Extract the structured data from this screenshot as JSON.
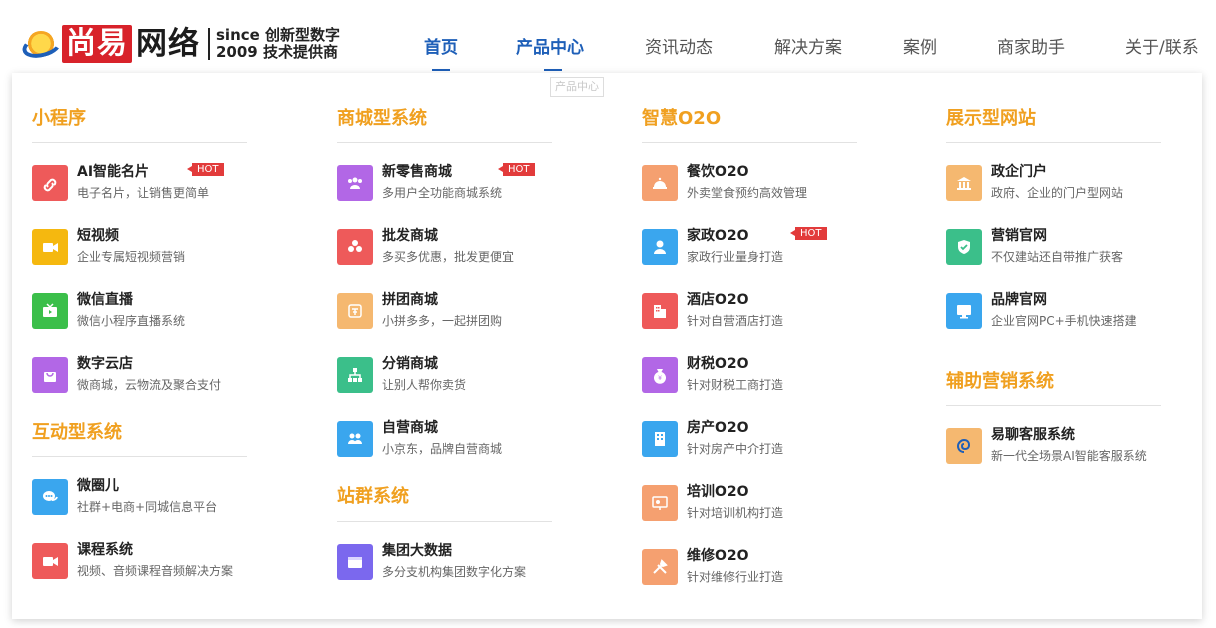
{
  "header": {
    "logo": {
      "red": "尚易",
      "black": "网络",
      "tag_line1": "since 创新型数字",
      "tag_line2": "2009 技术提供商"
    },
    "nav": [
      {
        "label": "首页",
        "active": true
      },
      {
        "label": "产品中心",
        "active": true
      },
      {
        "label": "资讯动态",
        "active": false
      },
      {
        "label": "解决方案",
        "active": false
      },
      {
        "label": "案例",
        "active": false
      },
      {
        "label": "商家助手",
        "active": false
      },
      {
        "label": "关于/联系",
        "active": false
      }
    ],
    "tooltip": "产品中心"
  },
  "hot_label": "HOT",
  "columns": {
    "miniprogram": {
      "title": "小程序",
      "items": [
        {
          "title": "AI智能名片",
          "desc": "电子名片，让销售更简单",
          "hot": true,
          "icon": "link-icon",
          "color": "#ee5a5a"
        },
        {
          "title": "短视频",
          "desc": "企业专属短视频营销",
          "hot": false,
          "icon": "video-camera-icon",
          "color": "#f5b80f"
        },
        {
          "title": "微信直播",
          "desc": "微信小程序直播系统",
          "hot": false,
          "icon": "tv-icon",
          "color": "#3bbf4a"
        },
        {
          "title": "数字云店",
          "desc": "微商城，云物流及聚合支付",
          "hot": false,
          "icon": "shopping-bag-icon",
          "color": "#b267e6"
        }
      ]
    },
    "interactive": {
      "title": "互动型系统",
      "items": [
        {
          "title": "微圈儿",
          "desc": "社群+电商+同城信息平台",
          "hot": false,
          "icon": "chat-bubbles-icon",
          "color": "#3aa6ee"
        },
        {
          "title": "课程系统",
          "desc": "视频、音频课程音频解决方案",
          "hot": false,
          "icon": "video-icon",
          "color": "#ee5a5a"
        }
      ]
    },
    "mall": {
      "title": "商城型系统",
      "items": [
        {
          "title": "新零售商城",
          "desc": "多用户全功能商城系统",
          "hot": true,
          "icon": "users-icon",
          "color": "#b267e6"
        },
        {
          "title": "批发商城",
          "desc": "多买多优惠，批发更便宜",
          "hot": false,
          "icon": "boxes-icon",
          "color": "#ee5a5a"
        },
        {
          "title": "拼团商城",
          "desc": "小拼多多，一起拼团购",
          "hot": false,
          "icon": "group-icon",
          "color": "#f5b870"
        },
        {
          "title": "分销商城",
          "desc": "让别人帮你卖货",
          "hot": false,
          "icon": "hierarchy-icon",
          "color": "#3bbf8a"
        },
        {
          "title": "自营商城",
          "desc": "小京东，品牌自营商城",
          "hot": false,
          "icon": "people-icon",
          "color": "#3aa6ee"
        }
      ]
    },
    "sitegroup": {
      "title": "站群系统",
      "items": [
        {
          "title": "集团大数据",
          "desc": "多分支机构集团数字化方案",
          "hot": false,
          "icon": "browser-icon",
          "color": "#7b68ee"
        }
      ]
    },
    "o2o": {
      "title": "智慧O2O",
      "items": [
        {
          "title": "餐饮O2O",
          "desc": "外卖堂食预约高效管理",
          "hot": false,
          "icon": "cloche-icon",
          "color": "#f5a070"
        },
        {
          "title": "家政O2O",
          "desc": "家政行业量身打造",
          "hot": true,
          "icon": "housekeeper-icon",
          "color": "#3aa6ee"
        },
        {
          "title": "酒店O2O",
          "desc": "针对自营酒店打造",
          "hot": false,
          "icon": "hotel-icon",
          "color": "#ee5a5a"
        },
        {
          "title": "财税O2O",
          "desc": "针对财税工商打造",
          "hot": false,
          "icon": "money-bag-icon",
          "color": "#b267e6"
        },
        {
          "title": "房产O2O",
          "desc": "针对房产中介打造",
          "hot": false,
          "icon": "building-icon",
          "color": "#3aa6ee"
        },
        {
          "title": "培训O2O",
          "desc": "针对培训机构打造",
          "hot": false,
          "icon": "presentation-icon",
          "color": "#f5a070"
        },
        {
          "title": "维修O2O",
          "desc": "针对维修行业打造",
          "hot": false,
          "icon": "tools-icon",
          "color": "#f5a070"
        }
      ]
    },
    "showcase": {
      "title": "展示型网站",
      "items": [
        {
          "title": "政企门户",
          "desc": "政府、企业的门户型网站",
          "hot": false,
          "icon": "government-icon",
          "color": "#f5b870"
        },
        {
          "title": "营销官网",
          "desc": "不仅建站还自带推广获客",
          "hot": false,
          "icon": "shield-check-icon",
          "color": "#3bbf8a"
        },
        {
          "title": "品牌官网",
          "desc": "企业官网PC+手机快速搭建",
          "hot": false,
          "icon": "monitor-icon",
          "color": "#3aa6ee"
        }
      ]
    },
    "assist": {
      "title": "辅助营销系统",
      "items": [
        {
          "title": "易聊客服系统",
          "desc": "新一代全场景AI智能客服系统",
          "hot": false,
          "icon": "spiral-chat-icon",
          "color": "#f5b870"
        }
      ]
    }
  }
}
